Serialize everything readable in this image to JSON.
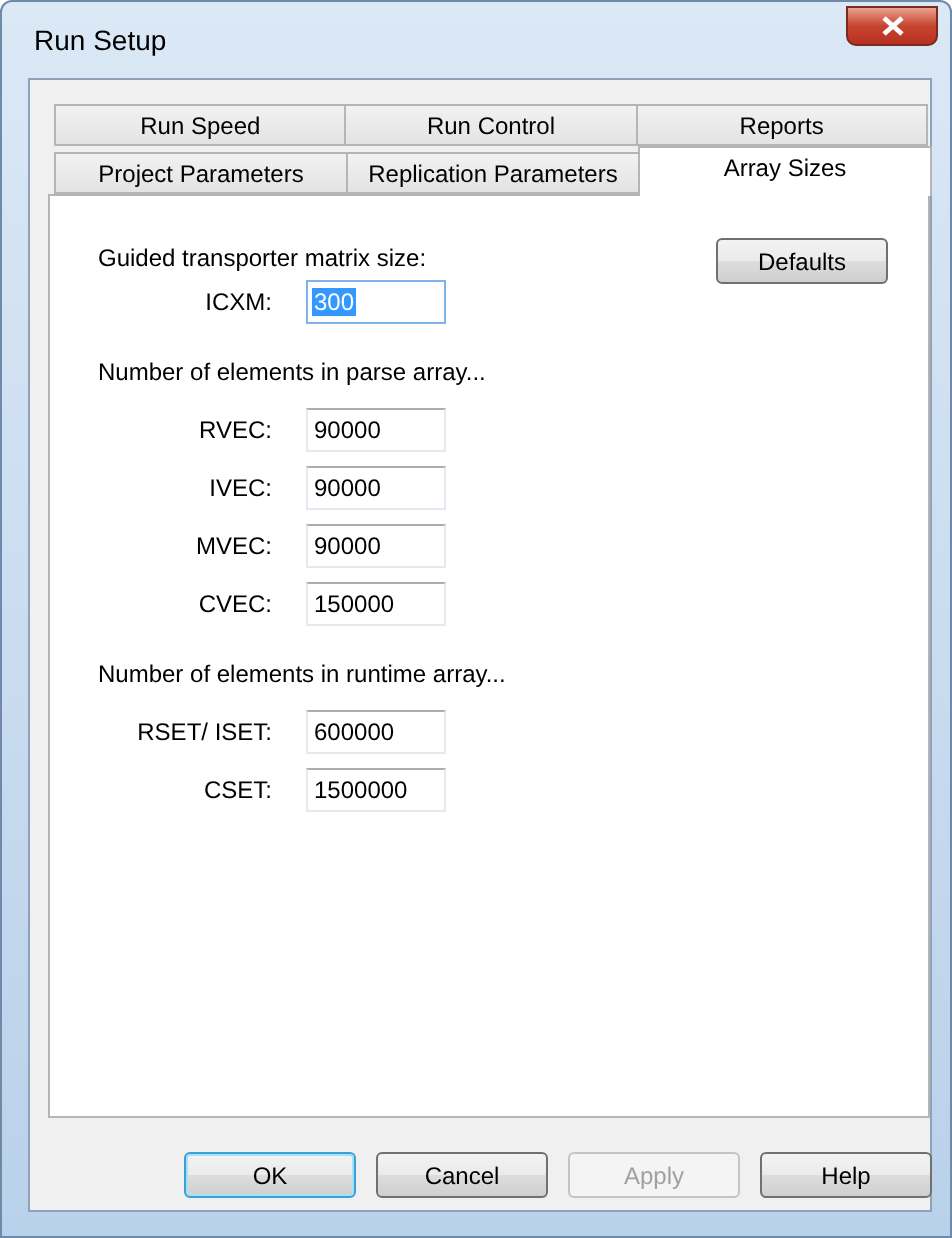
{
  "window": {
    "title": "Run Setup"
  },
  "tab_rows": [
    {
      "tabs": [
        {
          "label": "Run Speed",
          "selected": false
        },
        {
          "label": "Run Control",
          "selected": false
        },
        {
          "label": "Reports",
          "selected": false
        }
      ]
    },
    {
      "tabs": [
        {
          "label": "Project Parameters",
          "selected": false
        },
        {
          "label": "Replication Parameters",
          "selected": false
        },
        {
          "label": "Array Sizes",
          "selected": true
        }
      ]
    }
  ],
  "defaults_button": "Defaults",
  "sections": [
    {
      "heading": "Guided transporter matrix size:",
      "fields": [
        {
          "label": "ICXM:",
          "value": "300",
          "highlighted": true
        }
      ]
    },
    {
      "heading": "Number of elements in parse array...",
      "fields": [
        {
          "label": "RVEC:",
          "value": "90000",
          "highlighted": false
        },
        {
          "label": "IVEC:",
          "value": "90000",
          "highlighted": false
        },
        {
          "label": "MVEC:",
          "value": "90000",
          "highlighted": false
        },
        {
          "label": "CVEC:",
          "value": "150000",
          "highlighted": false
        }
      ]
    },
    {
      "heading": "Number of elements in runtime array...",
      "fields": [
        {
          "label": "RSET/ ISET:",
          "value": "600000",
          "highlighted": false
        },
        {
          "label": "CSET:",
          "value": "1500000",
          "highlighted": false
        }
      ]
    }
  ],
  "buttons": [
    {
      "label": "OK",
      "default": true,
      "disabled": false
    },
    {
      "label": "Cancel",
      "default": false,
      "disabled": false
    },
    {
      "label": "Apply",
      "default": false,
      "disabled": true
    },
    {
      "label": "Help",
      "default": false,
      "disabled": false
    }
  ]
}
